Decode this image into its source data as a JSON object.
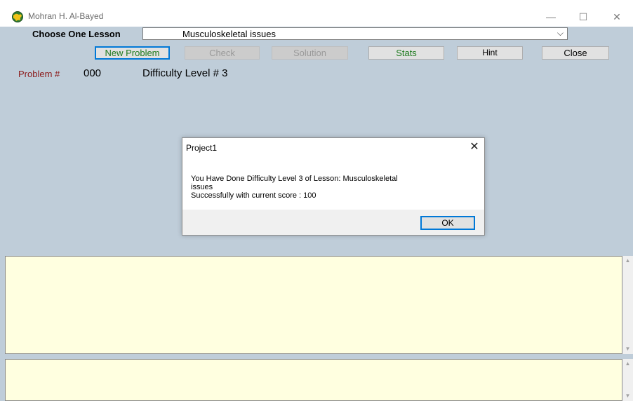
{
  "window": {
    "title": "Mohran H. Al-Bayed",
    "icon": "app-globe-icon",
    "controls": {
      "minimize": "—",
      "maximize": "☐",
      "close": "✕"
    }
  },
  "lesson": {
    "label": "Choose One Lesson",
    "selected": "Musculoskeletal issues",
    "chevron": "⌵"
  },
  "toolbar": {
    "new_problem": "New Problem",
    "check": "Check",
    "solution": "Solution",
    "stats": "Stats",
    "hint": "Hint",
    "close": "Close"
  },
  "problem": {
    "label": "Problem #",
    "number": "000",
    "difficulty": "Difficulty Level # 3"
  },
  "dialog": {
    "title": "Project1",
    "close": "✕",
    "message": "You Have Done Difficulty Level 3 of Lesson: Musculoskeletal\nissues\n Successfully with current score : 100",
    "ok": "OK"
  },
  "scroll": {
    "up": "▲",
    "down": "▼"
  },
  "colors": {
    "client_bg": "#bfcdd9",
    "textarea_bg": "#ffffe0",
    "green_text": "#1e7a1e",
    "problem_label": "#8b1a1a",
    "accent": "#0078d7"
  }
}
